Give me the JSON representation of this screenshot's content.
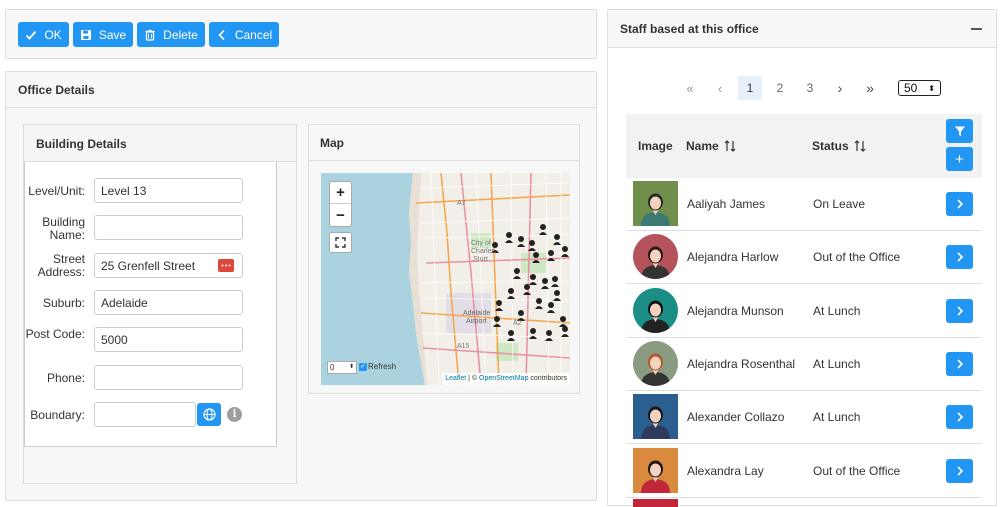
{
  "toolbar": {
    "ok_label": "OK",
    "save_label": "Save",
    "delete_label": "Delete",
    "cancel_label": "Cancel"
  },
  "office_details": {
    "title": "Office Details",
    "building": {
      "title": "Building Details",
      "fields": {
        "level": {
          "label": "Level/Unit:",
          "value": "Level 13"
        },
        "building_name": {
          "label": "Building Name:",
          "value": ""
        },
        "street": {
          "label": "Street Address:",
          "value": "25 Grenfell Street"
        },
        "suburb": {
          "label": "Suburb:",
          "value": "Adelaide"
        },
        "postcode": {
          "label": "Post Code:",
          "value": "5000"
        },
        "phone": {
          "label": "Phone:",
          "value": ""
        },
        "boundary": {
          "label": "Boundary:",
          "value": ""
        }
      }
    },
    "map": {
      "title": "Map",
      "zoom_in": "+",
      "zoom_out": "−",
      "refresh_value": "0",
      "refresh_label": "Refresh",
      "attribution_leaflet": "Leaflet",
      "attribution_sep": " | © ",
      "attribution_osm": "OpenStreetMap",
      "attribution_contrib": " contributors",
      "place_labels": {
        "city": "City of",
        "city2": "Charles",
        "city3": "Sturt",
        "airport1": "Adelaide",
        "airport2": "Airport",
        "a7": "A7",
        "a2": "A2",
        "a15": "A15"
      }
    }
  },
  "staff": {
    "title": "Staff based at this office",
    "collapse_icon": "minus-icon",
    "pager": {
      "first": "«",
      "prev": "‹",
      "pages": [
        "1",
        "2",
        "3"
      ],
      "next": "›",
      "last": "»",
      "page_size": "50"
    },
    "columns": {
      "image": "Image",
      "name": "Name",
      "status": "Status"
    },
    "rows": [
      {
        "name": "Aaliyah James",
        "status": "On Leave",
        "bg": "#6f8f4a",
        "shirt": "#3a7a72",
        "hair": "#2b2b2b",
        "round": false
      },
      {
        "name": "Alejandra Harlow",
        "status": "Out of the Office",
        "bg": "#b5535a",
        "shirt": "#333",
        "hair": "#2a1a14",
        "round": true
      },
      {
        "name": "Alejandra Munson",
        "status": "At Lunch",
        "bg": "#1b8f86",
        "shirt": "#222",
        "hair": "#111",
        "round": true
      },
      {
        "name": "Alejandra Rosenthal",
        "status": "At Lunch",
        "bg": "#8b9b82",
        "shirt": "#333",
        "hair": "#b05a2a",
        "round": true
      },
      {
        "name": "Alexander Collazo",
        "status": "At Lunch",
        "bg": "#2a5f8f",
        "shirt": "#2e3a5a",
        "hair": "#1a1a1a",
        "round": false
      },
      {
        "name": "Alexandra Lay",
        "status": "Out of the Office",
        "bg": "#d98a3c",
        "shirt": "#c0283a",
        "hair": "#1e1512",
        "round": false
      }
    ]
  }
}
